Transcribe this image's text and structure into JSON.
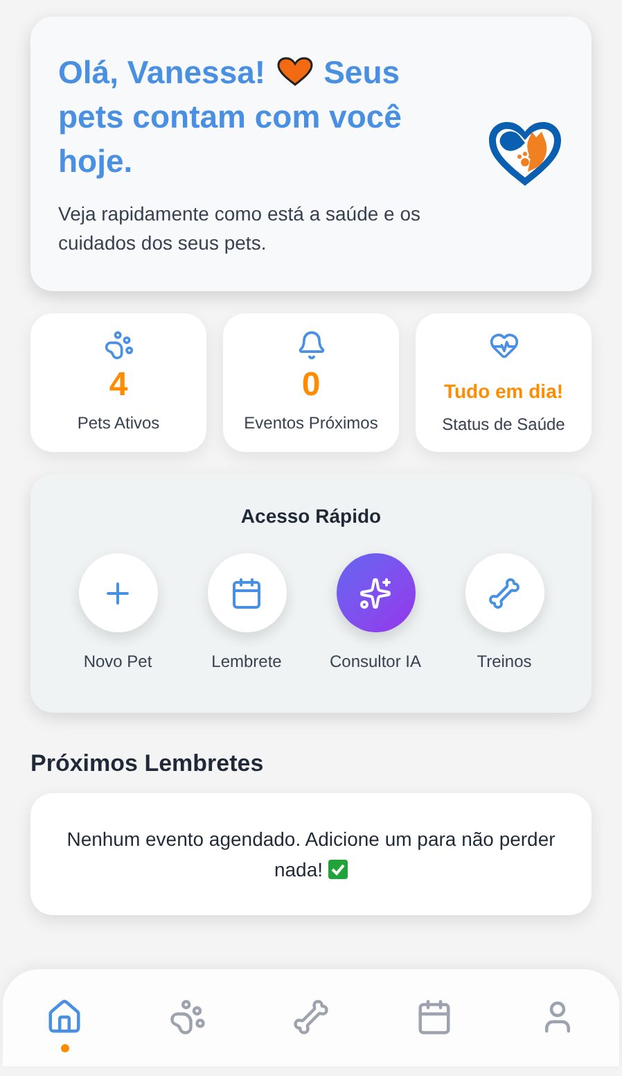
{
  "greeting": {
    "name_line": "Olá, Vanessa!",
    "message_start": "Seus",
    "message_rest": "pets contam com você hoje.",
    "subtitle": "Veja rapidamente como está a saúde e os cuidados dos seus pets."
  },
  "stats": [
    {
      "kind": "paw",
      "value": "4",
      "label": "Pets Ativos"
    },
    {
      "kind": "bell",
      "value": "0",
      "label": "Eventos Próximos"
    },
    {
      "kind": "health",
      "value": "Tudo em dia!",
      "label": "Status de Saúde"
    }
  ],
  "quick_access": {
    "title": "Acesso Rápido",
    "items": [
      {
        "kind": "plus",
        "label": "Novo Pet",
        "highlighted": false
      },
      {
        "kind": "calendar",
        "label": "Lembrete",
        "highlighted": false
      },
      {
        "kind": "sparkles",
        "label": "Consultor IA",
        "highlighted": true
      },
      {
        "kind": "bone",
        "label": "Treinos",
        "highlighted": false
      }
    ]
  },
  "reminders": {
    "title": "Próximos Lembretes",
    "empty_message": "Nenhum evento agendado. Adicione um para não perder",
    "empty_message_end": "nada!"
  },
  "nav": [
    {
      "kind": "home",
      "selected": true
    },
    {
      "kind": "paw",
      "selected": false
    },
    {
      "kind": "bone",
      "selected": false
    },
    {
      "kind": "calendar",
      "selected": false
    },
    {
      "kind": "user",
      "selected": false
    }
  ]
}
